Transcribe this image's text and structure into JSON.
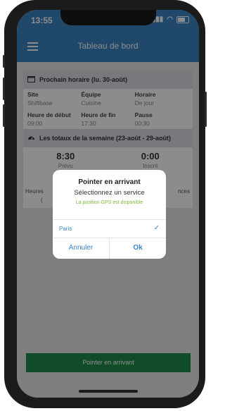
{
  "status": {
    "time": "13:55"
  },
  "nav": {
    "title": "Tableau de bord"
  },
  "next_shift": {
    "title": "Prochain horaire (lu. 30-août)",
    "rows": [
      [
        {
          "label": "Site",
          "value": "Shiftbase"
        },
        {
          "label": "Équipe",
          "value": "Cuisine"
        },
        {
          "label": "Horaire",
          "value": "De jour"
        }
      ],
      [
        {
          "label": "Heure de début",
          "value": "09:00"
        },
        {
          "label": "Heure de fin",
          "value": "17:30"
        },
        {
          "label": "Pause",
          "value": "00:30"
        }
      ]
    ]
  },
  "weekly": {
    "title": "Les totaux de la semaine (23-août - 29-août)",
    "items": [
      {
        "value": "8:30",
        "label": "Prévu"
      },
      {
        "value": "0:00",
        "label": "Inscrit"
      }
    ],
    "partial": {
      "left": "Heures",
      "left2": "(",
      "right": "nces"
    }
  },
  "dialog": {
    "title": "Pointer en arrivant",
    "subtitle": "Sélectionnez un service",
    "gps": "La position GPS est disponible",
    "option": "Paris",
    "cancel": "Annuler",
    "ok": "Ok"
  },
  "bottom_button": "Pointer en arrivant",
  "colors": {
    "primary": "#3a83c4",
    "success": "#1f8a4c",
    "gps": "#7dbb3c"
  }
}
